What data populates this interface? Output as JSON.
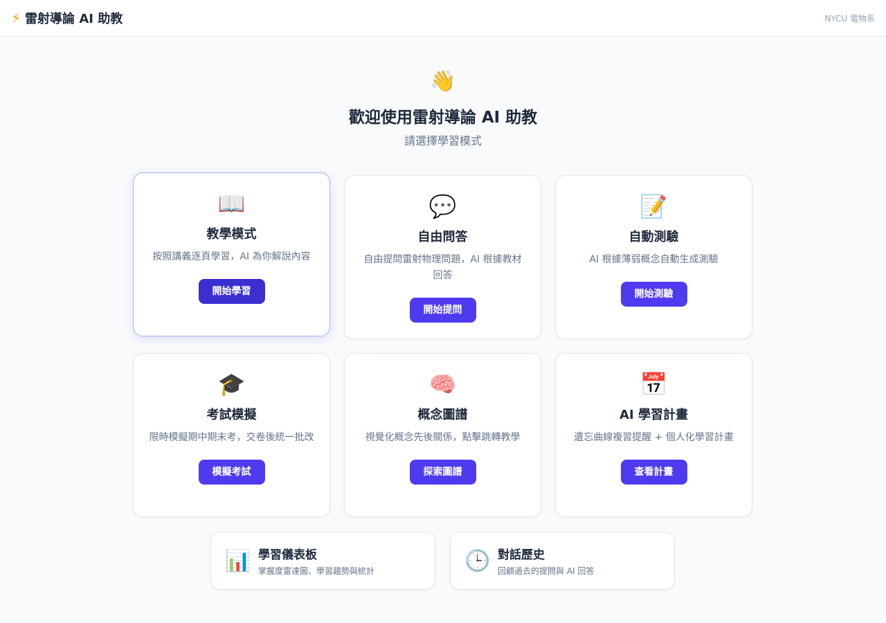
{
  "header": {
    "bolt_icon": "⚡",
    "title": "雷射導論 AI 助教",
    "org": "NYCU 電物系"
  },
  "welcome": {
    "icon": "👋",
    "title": "歡迎使用雷射導論 AI 助教",
    "subtitle": "請選擇學習模式"
  },
  "modes": [
    {
      "icon": "📖",
      "title": "教學模式",
      "desc": "按照講義逐頁學習，AI 為你解說內容",
      "button": "開始學習"
    },
    {
      "icon": "💬",
      "title": "自由問答",
      "desc": "自由提問雷射物理問題，AI 根據教材回答",
      "button": "開始提問"
    },
    {
      "icon": "📝",
      "title": "自動測驗",
      "desc": "AI 根據薄弱概念自動生成測驗",
      "button": "開始測驗"
    },
    {
      "icon": "🎓",
      "title": "考試模擬",
      "desc": "限時模擬期中期末考，交卷後統一批改",
      "button": "模擬考試"
    },
    {
      "icon": "🧠",
      "title": "概念圖譜",
      "desc": "視覺化概念先後關係，點擊跳轉教學",
      "button": "探索圖譜"
    },
    {
      "icon": "📅",
      "title": "AI 學習計畫",
      "desc": "遺忘曲線複習提醒 + 個人化學習計畫",
      "button": "查看計畫"
    }
  ],
  "extras": [
    {
      "icon": "📊",
      "title": "學習儀表板",
      "desc": "掌握度雷達圖、學習趨勢與統計"
    },
    {
      "icon": "🕒",
      "title": "對話歷史",
      "desc": "回顧過去的提問與 AI 回答"
    }
  ],
  "colors": {
    "accent": "#4f3bef",
    "accent_active": "#3b2fd0",
    "background": "#f8fafc"
  }
}
